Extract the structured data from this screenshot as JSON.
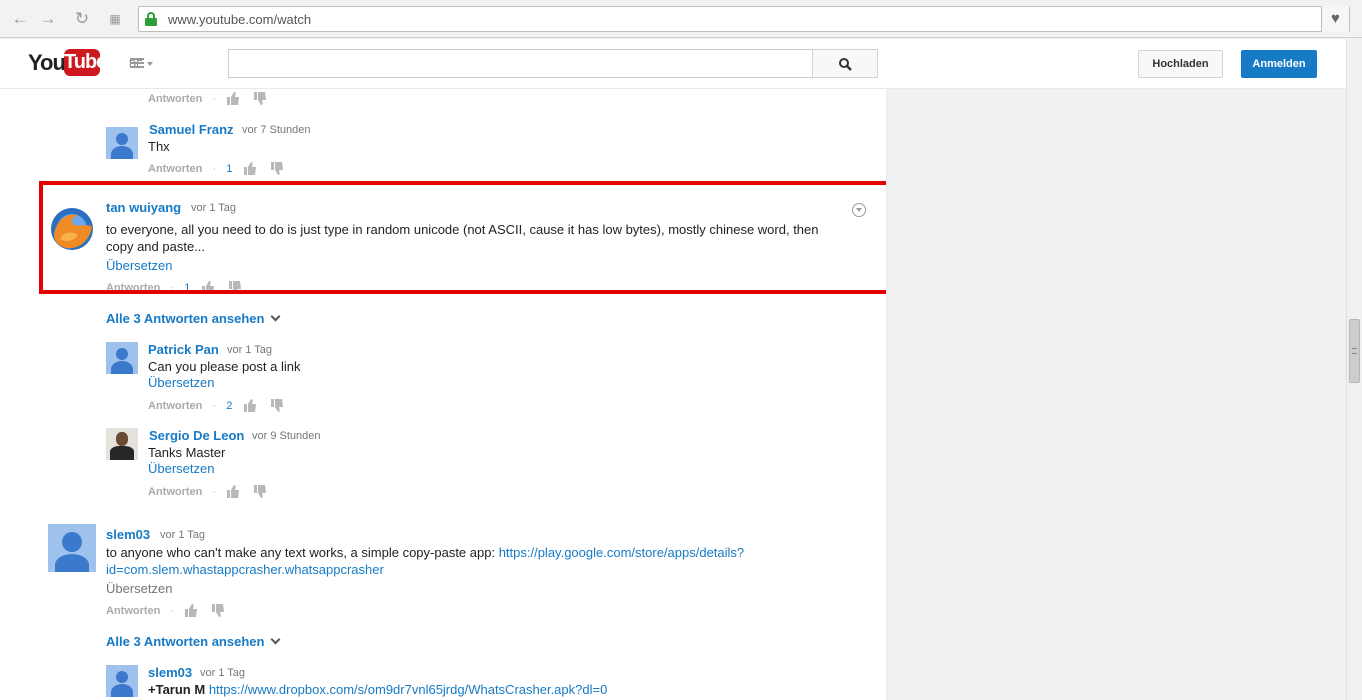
{
  "browser": {
    "url": "www.youtube.com/watch"
  },
  "header": {
    "logo_you": "You",
    "logo_tube": "Tube",
    "region": "DE",
    "search_placeholder": "",
    "upload_label": "Hochladen",
    "signin_label": "Anmelden"
  },
  "labels": {
    "reply": "Antworten",
    "translate": "Übersetzen",
    "view_replies": "Alle 3 Antworten ansehen",
    "dot": "·"
  },
  "comments": {
    "top_reply": {
      "likes": ""
    },
    "samuel": {
      "author": "Samuel Franz",
      "time": "vor 7 Stunden",
      "text": "Thx",
      "likes": "1"
    },
    "tan": {
      "author": "tan wuiyang",
      "time": "vor 1 Tag",
      "text": "to everyone, all you need to do is just type in random unicode (not ASCII, cause it has low bytes), mostly chinese word, then copy and paste...",
      "likes": "1"
    },
    "patrick": {
      "author": "Patrick Pan",
      "time": "vor 1 Tag",
      "text": "Can you please post a link",
      "likes": "2"
    },
    "sergio": {
      "author": "Sergio De Leon",
      "time": "vor 9 Stunden",
      "text": "Tanks Master"
    },
    "slem_main": {
      "author": "slem03",
      "time": "vor 1 Tag",
      "text": "to anyone who can't make any text works, a simple copy-paste app: ",
      "link": "https://play.google.com/store/apps/details?id=com.slem.whastappcrasher.whatsappcrasher"
    },
    "slem_reply": {
      "author": "slem03",
      "time": "vor 1 Tag",
      "mention": "+Tarun M",
      "link": "https://www.dropbox.com/s/om9dr7vnl65jrdg/WhatsCrasher.apk?dl=0"
    }
  },
  "colors": {
    "link_blue": "#167ac6",
    "highlight_red": "#e50000",
    "youtube_red": "#cc181e"
  }
}
